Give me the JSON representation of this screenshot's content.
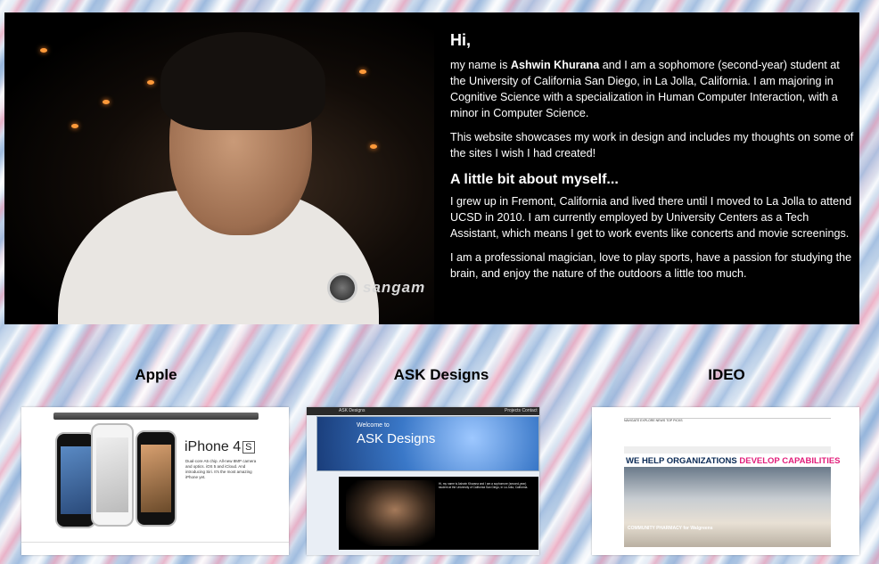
{
  "intro": {
    "greeting": "Hi,",
    "p1_before": "my name is ",
    "p1_name": "Ashwin Khurana",
    "p1_after": " and I am a sophomore (second-year) student at the University of California San Diego, in La Jolla, California. I am majoring in Cognitive Science with a specialization in Human Computer Interaction, with a minor in Computer Science.",
    "p2": "This website showcases my work in design and includes my thoughts on some of the sites I wish I had created!",
    "heading2": "A little bit about myself...",
    "p3": "I grew up in Fremont, California and lived there until I moved to La Jolla to attend UCSD in 2010. I am currently employed by University Centers as a Tech Assistant, which means I get to work events like concerts and movie screenings.",
    "p4": "I am a professional magician, love to play sports, have a passion for studying the brain, and enjoy the nature of the outdoors a little too much.",
    "watermark": "sangam"
  },
  "cards": [
    {
      "title": "Apple"
    },
    {
      "title": "ASK Designs"
    },
    {
      "title": "IDEO"
    }
  ],
  "apple_thumb": {
    "headline": "iPhone 4",
    "badge": "S",
    "copy": "Dual-core A5 chip. All-new 8MP camera and optics. iOS 5 and iCloud. And introducing Siri. It's the most amazing iPhone yet."
  },
  "ask_thumb": {
    "brand": "ASK Designs",
    "nav": "Projects  Contact",
    "banner_small": "Welcome to",
    "banner_big": "ASK Designs",
    "body_text": "Hi, my name is Ashwin Khurana and I am a sophomore (second-year) student at the University of California San Diego, in La Jolla, California."
  },
  "ideo_thumb": {
    "header": "NAVIGATE   EXPLORE   NEWS   TOP PICKS",
    "headline_a": "WE HELP ORGANIZATIONS ",
    "headline_b": "DEVELOP CAPABILITIES",
    "caption": "COMMUNITY PHARMACY for Walgreens"
  }
}
